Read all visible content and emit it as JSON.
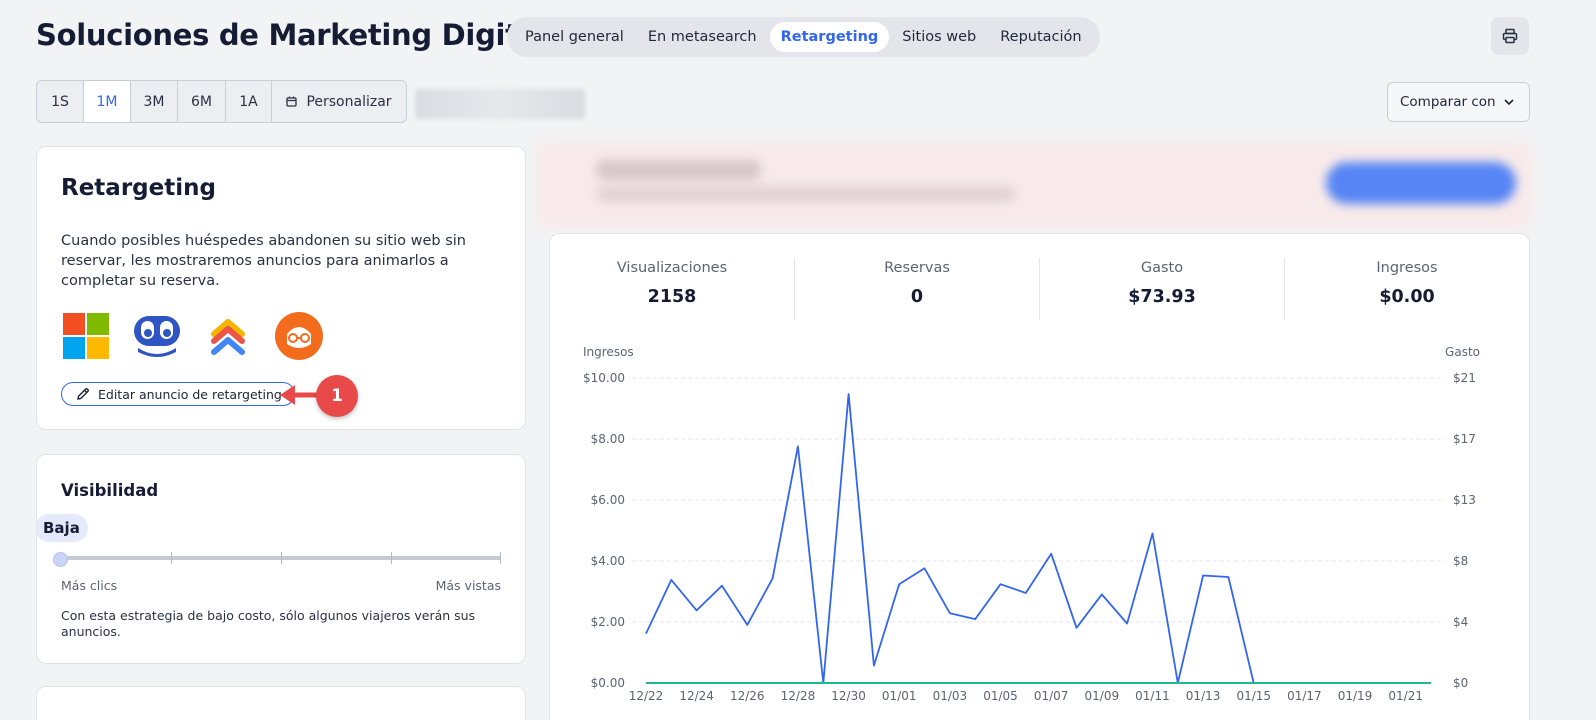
{
  "header": {
    "title": "Soluciones de Marketing Digital",
    "tabs": [
      {
        "label": "Panel general",
        "active": false
      },
      {
        "label": "En metasearch",
        "active": false
      },
      {
        "label": "Retargeting",
        "active": true
      },
      {
        "label": "Sitios web",
        "active": false
      },
      {
        "label": "Reputación",
        "active": false
      }
    ],
    "print_icon": "printer-icon"
  },
  "toolbar": {
    "ranges": [
      {
        "label": "1S",
        "active": false
      },
      {
        "label": "1M",
        "active": true
      },
      {
        "label": "3M",
        "active": false
      },
      {
        "label": "6M",
        "active": false
      },
      {
        "label": "1A",
        "active": false
      }
    ],
    "custom_label": "Personalizar",
    "custom_icon": "calendar-icon",
    "compare_label": "Comparar con",
    "compare_icon": "chevron-down-icon"
  },
  "retargeting_card": {
    "title": "Retargeting",
    "description": "Cuando posibles huéspedes abandonen su sitio web sin reservar, les mostraremos anuncios para animarlos a completar su reserva.",
    "logos": [
      "microsoft-logo",
      "tripadvisor-style-logo",
      "google-ads-logo",
      "outbrain-logo"
    ],
    "edit_button": "Editar anuncio de retargeting",
    "edit_icon": "pencil-icon"
  },
  "visibility_card": {
    "title": "Visibilidad",
    "level": "Baja",
    "slider_value": 0,
    "min_label": "Más clics",
    "max_label": "Más vistas",
    "description": "Con esta estrategia de bajo costo, sólo algunos viajeros verán sus anuncios."
  },
  "metrics": [
    {
      "label": "Visualizaciones",
      "value": "2158"
    },
    {
      "label": "Reservas",
      "value": "0"
    },
    {
      "label": "Gasto",
      "value": "$73.93"
    },
    {
      "label": "Ingresos",
      "value": "$0.00"
    }
  ],
  "annotation": {
    "number": "1"
  },
  "colors": {
    "accent": "#3366f0",
    "spend_line": "#3366f0",
    "revenue_line": "#1fb98a",
    "callout": "#e84a4a"
  },
  "chart_data": {
    "type": "line",
    "left_axis_title": "Ingresos",
    "right_axis_title": "Gasto",
    "left_ticks": [
      "$0.00",
      "$2.00",
      "$4.00",
      "$6.00",
      "$8.00",
      "$10.00"
    ],
    "right_ticks": [
      "$0",
      "$4",
      "$8",
      "$13",
      "$17",
      "$21"
    ],
    "left_ylim": [
      0,
      10
    ],
    "right_ylim": [
      0,
      21
    ],
    "x_tick_labels": [
      "12/22",
      "12/24",
      "12/26",
      "12/28",
      "12/30",
      "01/01",
      "01/03",
      "01/05",
      "01/07",
      "01/09",
      "01/11",
      "01/13",
      "01/15",
      "01/17",
      "01/19",
      "01/21"
    ],
    "x_dates": [
      "12/22",
      "12/23",
      "12/24",
      "12/25",
      "12/26",
      "12/27",
      "12/28",
      "12/29",
      "12/30",
      "12/31",
      "01/01",
      "01/02",
      "01/03",
      "01/04",
      "01/05",
      "01/06",
      "01/07",
      "01/08",
      "01/09",
      "01/10",
      "01/11",
      "01/12",
      "01/13",
      "01/14",
      "01/15",
      "01/16",
      "01/17",
      "01/18",
      "01/19",
      "01/20",
      "01/21",
      "01/22"
    ],
    "series": [
      {
        "name": "Gasto",
        "axis": "right",
        "values": [
          3.4,
          7.1,
          5.0,
          6.7,
          4.0,
          7.2,
          16.3,
          0.0,
          19.9,
          1.2,
          6.8,
          7.9,
          4.8,
          4.4,
          6.8,
          6.2,
          8.9,
          3.8,
          6.1,
          4.1,
          10.3,
          0.0,
          7.4,
          7.3,
          0.0,
          0.0,
          0.0,
          0.0,
          0.0,
          0.0,
          0.0,
          0.0
        ]
      },
      {
        "name": "Ingresos",
        "axis": "left",
        "values": [
          0,
          0,
          0,
          0,
          0,
          0,
          0,
          0,
          0,
          0,
          0,
          0,
          0,
          0,
          0,
          0,
          0,
          0,
          0,
          0,
          0,
          0,
          0,
          0,
          0,
          0,
          0,
          0,
          0,
          0,
          0,
          0
        ]
      }
    ],
    "grid": true
  }
}
